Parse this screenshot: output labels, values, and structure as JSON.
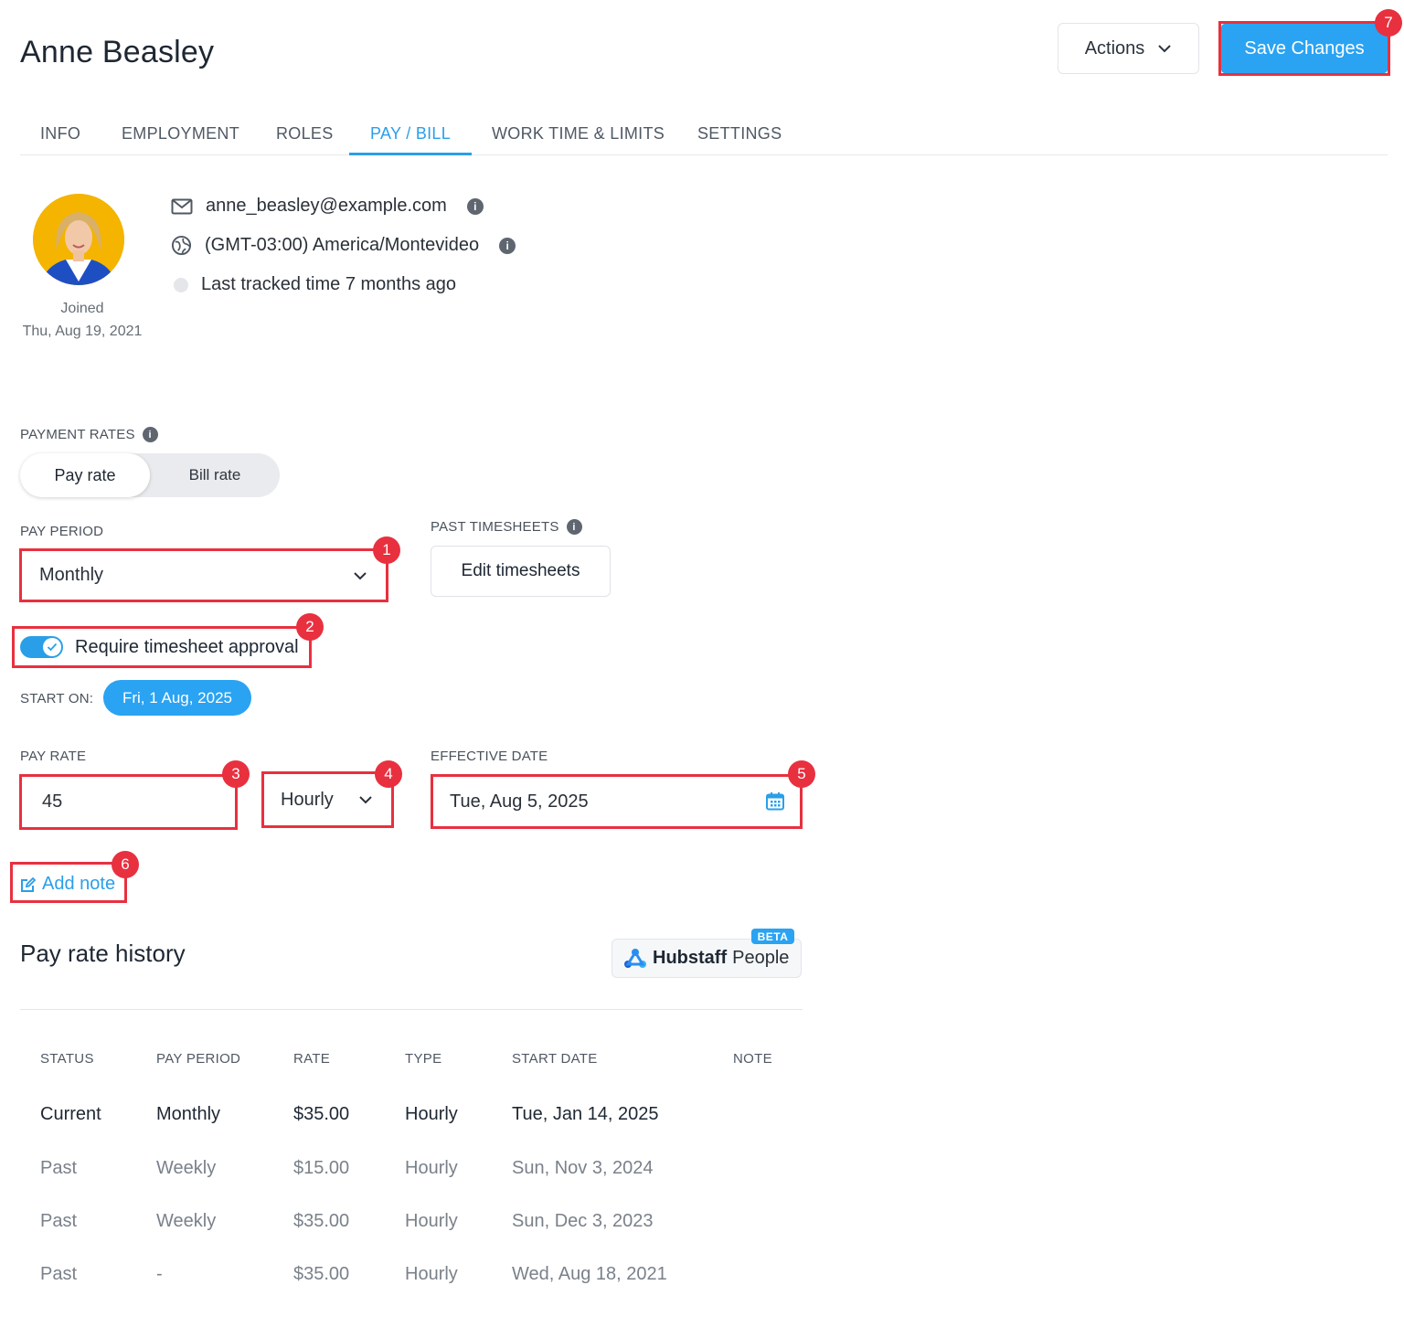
{
  "header": {
    "title": "Anne Beasley",
    "actions_label": "Actions",
    "save_label": "Save Changes"
  },
  "tabs": [
    {
      "label": "INFO"
    },
    {
      "label": "EMPLOYMENT"
    },
    {
      "label": "ROLES"
    },
    {
      "label": "PAY / BILL",
      "active": true
    },
    {
      "label": "WORK TIME & LIMITS"
    },
    {
      "label": "SETTINGS"
    }
  ],
  "profile": {
    "joined_label": "Joined",
    "joined_date": "Thu, Aug 19, 2021",
    "email": "anne_beasley@example.com",
    "timezone": "(GMT-03:00) America/Montevideo",
    "last_tracked": "Last tracked time 7 months ago"
  },
  "payment_rates": {
    "label": "PAYMENT RATES",
    "segments": [
      "Pay rate",
      "Bill rate"
    ],
    "selected": "Pay rate"
  },
  "pay_period": {
    "label": "PAY PERIOD",
    "value": "Monthly"
  },
  "past_timesheets": {
    "label": "PAST TIMESHEETS",
    "button": "Edit timesheets"
  },
  "approval": {
    "label": "Require timesheet approval",
    "enabled": true
  },
  "start_on": {
    "label": "START ON:",
    "value": "Fri, 1 Aug, 2025"
  },
  "pay_rate": {
    "label": "PAY RATE",
    "value": "45",
    "type": "Hourly"
  },
  "effective_date": {
    "label": "EFFECTIVE DATE",
    "value": "Tue, Aug 5, 2025"
  },
  "add_note": "Add note",
  "history": {
    "title": "Pay rate history",
    "brand": {
      "name": "Hubstaff",
      "product": "People",
      "badge": "BETA"
    },
    "columns": [
      "STATUS",
      "PAY PERIOD",
      "RATE",
      "TYPE",
      "START DATE",
      "NOTE"
    ],
    "rows": [
      {
        "status": "Current",
        "period": "Monthly",
        "rate": "$35.00",
        "type": "Hourly",
        "start": "Tue, Jan 14, 2025",
        "note": ""
      },
      {
        "status": "Past",
        "period": "Weekly",
        "rate": "$15.00",
        "type": "Hourly",
        "start": "Sun, Nov 3, 2024",
        "note": ""
      },
      {
        "status": "Past",
        "period": "Weekly",
        "rate": "$35.00",
        "type": "Hourly",
        "start": "Sun, Dec 3, 2023",
        "note": ""
      },
      {
        "status": "Past",
        "period": "-",
        "rate": "$35.00",
        "type": "Hourly",
        "start": "Wed, Aug 18, 2021",
        "note": ""
      }
    ]
  },
  "annotations": [
    "1",
    "2",
    "3",
    "4",
    "5",
    "6",
    "7"
  ],
  "colors": {
    "accent": "#2aa3f2",
    "highlight": "#e8303f"
  }
}
